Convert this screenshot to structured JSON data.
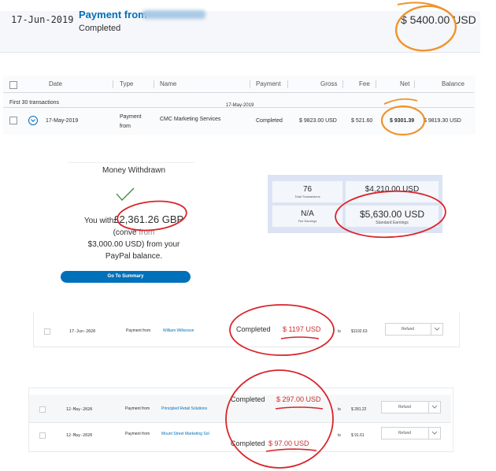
{
  "transaction": {
    "date": "17-Jun-2019",
    "title": "Payment from",
    "status": "Completed",
    "amount": "$ 5400.00",
    "currency": "USD"
  },
  "activity_table": {
    "columns": [
      "Date",
      "Type",
      "Name",
      "Payment",
      "Gross",
      "Fee",
      "Net",
      "Balance"
    ],
    "group_label": "First 30 transactions",
    "group_date": "17-May-2019",
    "row": {
      "date": "17-May-2019",
      "type_line1": "Payment",
      "type_line2": "from",
      "name": "CMC Marketing Services",
      "payment": "Completed",
      "gross": "$ 9823.00 USD",
      "fee": "$ 521.60",
      "net": "$ 9301.39",
      "balance": "$ 9819.30 USD"
    }
  },
  "withdrawal": {
    "title": "Money Withdrawn",
    "text_before": "You with",
    "amount": "£2,361.26 GBP",
    "line2": "(conve",
    "line2_tail": "from",
    "line3": "$3,000.00 USD) from your",
    "line4": "PayPal balance.",
    "button": "Go To Summary"
  },
  "stats": {
    "transactions_value": "76",
    "transactions_label": "Total Transactions",
    "top_right_value": "$4,210.00 USD",
    "fee_value": "N/A",
    "fee_label": "Fee Earnings",
    "standard_value": "$5,630.00 USD",
    "standard_label": "Standard Earnings"
  },
  "row_2020": {
    "date": "17-Jun-2020",
    "type": "Payment from",
    "name": "William Wilkerson",
    "status": "Completed",
    "amount": "$ 1197 USD",
    "fee_prefix": "ts",
    "value": "$1192.63",
    "action": "Refund"
  },
  "rows_2020_may": [
    {
      "date": "12-May-2020",
      "type": "Payment from",
      "name": "Principled Retail Solutions",
      "status": "Completed",
      "amount": "$ 297.00 USD",
      "fee_prefix": "ts",
      "value": "$ 281.22",
      "action": "Refund"
    },
    {
      "date": "12-May-2020",
      "type": "Payment from",
      "name": "Mount Street Marketing Sol",
      "status": "Completed",
      "amount": "$ 97.00 USD",
      "fee_prefix": "ts",
      "value": "$ 91.61",
      "action": "Refund"
    }
  ],
  "colors": {
    "paypal_blue": "#0070ba",
    "annotation_orange": "#f0932b",
    "annotation_red": "#d9242a"
  }
}
